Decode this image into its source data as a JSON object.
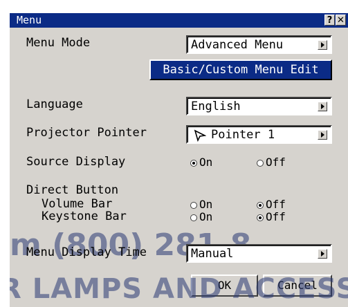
{
  "window": {
    "title": "Menu",
    "help_label": "?",
    "close_label": "✕"
  },
  "rows": {
    "menu_mode": {
      "label": "Menu Mode",
      "value": "Advanced Menu"
    },
    "basic_custom": {
      "label": "Basic/Custom Menu Edit"
    },
    "language": {
      "label": "Language",
      "value": "English"
    },
    "projector_pointer": {
      "label": "Projector Pointer",
      "value": "Pointer 1"
    },
    "source_display": {
      "label": "Source Display",
      "on": "On",
      "off": "Off",
      "selected": "On"
    },
    "direct_button": {
      "label": "Direct Button"
    },
    "volume_bar": {
      "label": "Volume Bar",
      "on": "On",
      "off": "Off",
      "selected": "Off"
    },
    "keystone_bar": {
      "label": "Keystone Bar",
      "on": "On",
      "off": "Off",
      "selected": "Off"
    },
    "menu_display_time": {
      "label": "Menu Display Time",
      "value": "Manual"
    }
  },
  "buttons": {
    "ok": "OK",
    "cancel": "Cancel"
  },
  "watermark": {
    "line1": "m (800) 281-8",
    "line2": "R LAMPS AND ACCESSORI"
  }
}
